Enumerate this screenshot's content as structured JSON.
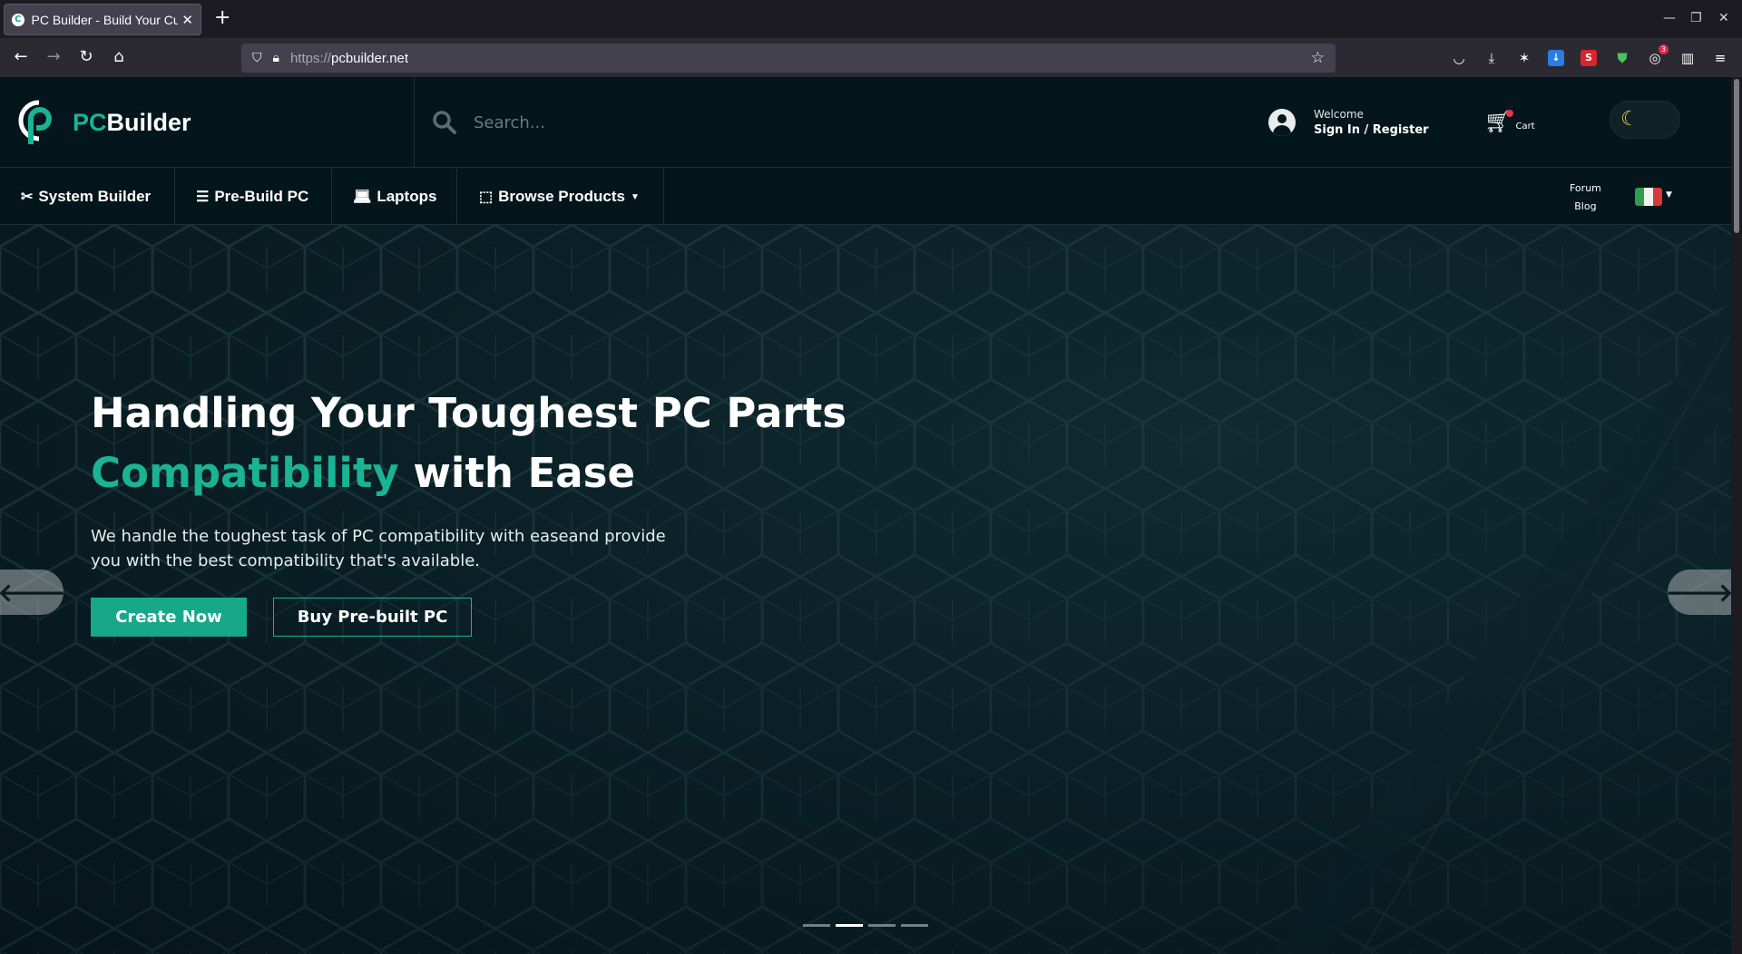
{
  "browser": {
    "tab_title": "PC Builder - Build Your Custom PC",
    "tab_favicon": "C",
    "new_tab_label": "+",
    "url_protocol": "https://",
    "url_host": "pcbuilder.net",
    "extension_badge": "3"
  },
  "header": {
    "logo_pc": "PC",
    "logo_builder": "Builder",
    "search_placeholder": "Search...",
    "welcome": "Welcome",
    "sign_in": "Sign In / Register",
    "cart_label": "Cart",
    "theme_icon": "moon-icon"
  },
  "nav": {
    "items": [
      {
        "label": "System Builder",
        "icon": "tools-icon"
      },
      {
        "label": "Pre-Build PC",
        "icon": "server-icon"
      },
      {
        "label": "Laptops",
        "icon": "laptop-icon"
      },
      {
        "label": "Browse Products",
        "icon": "cpu-icon"
      }
    ],
    "forum": "Forum",
    "blog": "Blog",
    "language_flag": "italy-flag"
  },
  "hero": {
    "title_line1": "Handling Your Toughest PC Parts",
    "title_accent": "Compatibility",
    "title_rest": " with Ease",
    "description": "We handle the toughest task of PC compatibility with easeand provide you with the best compatibility that's available.",
    "primary_button": "Create Now",
    "secondary_button": "Buy Pre-built PC",
    "slide_count": 4,
    "active_slide": 2
  },
  "colors": {
    "accent": "#1ab394",
    "header_bg": "#04161b",
    "hero_bg": "#0a2026"
  }
}
